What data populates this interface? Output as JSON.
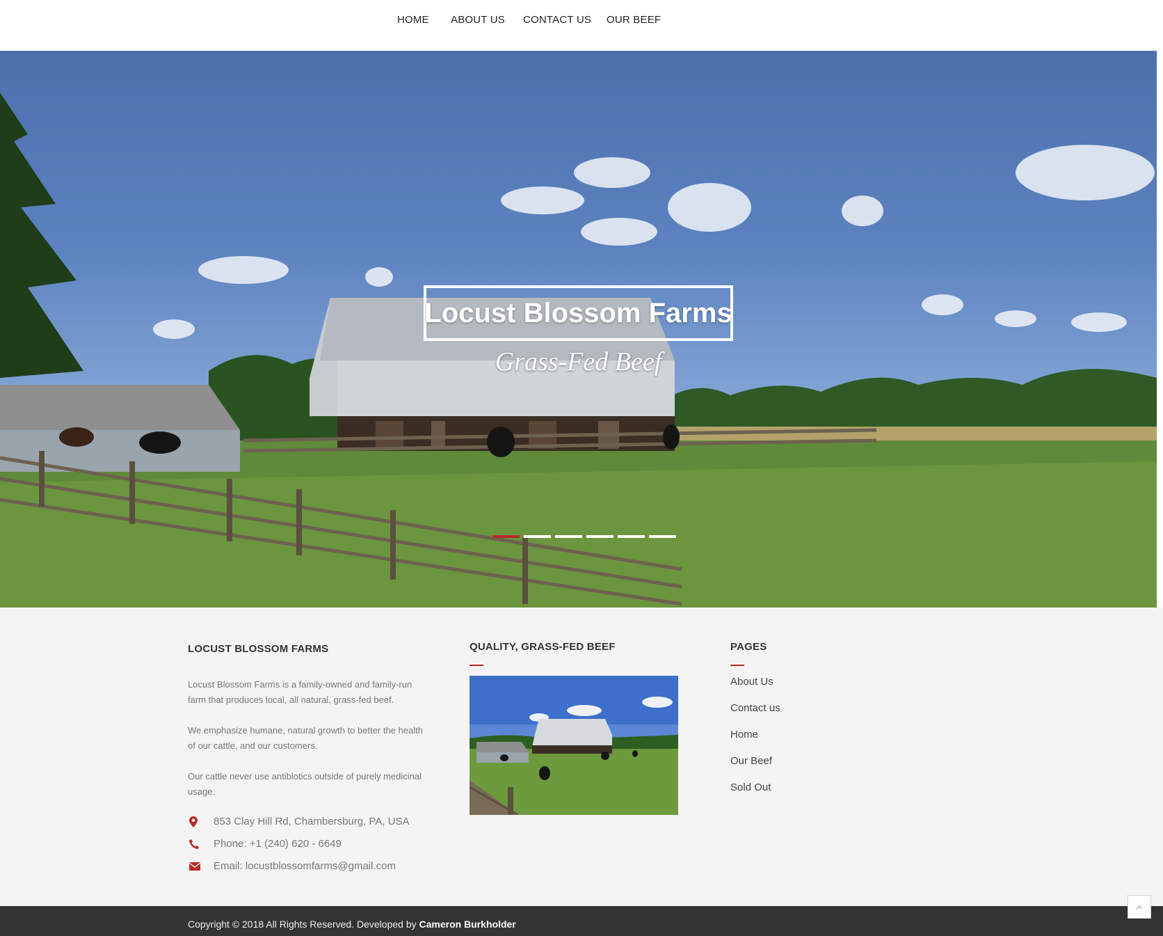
{
  "nav": {
    "items": [
      {
        "label": "HOME"
      },
      {
        "label": "ABOUT US"
      },
      {
        "label": "CONTACT US"
      },
      {
        "label": "OUR BEEF"
      }
    ]
  },
  "hero": {
    "title": "Locust Blossom Farms",
    "subtitle": "Grass-Fed Beef",
    "slides_total": 6,
    "active_slide": 1
  },
  "footer": {
    "about": {
      "heading": "LOCUST BLOSSOM FARMS",
      "paragraphs": [
        "Locust Blossom Farms is a family-owned and family-run farm that produces local, all natural, grass-fed beef.",
        "We emphasize humane, natural growth to better the health of our cattle, and our customers.",
        "Our cattle never use antibiotics outside of purely medicinal usage."
      ],
      "address": "853 Clay Hill Rd, Chambersburg, PA, USA",
      "phone": "Phone: +1 (240) 620 - 6649",
      "email": "Email: locustblossomfarms@gmail.com"
    },
    "gallery": {
      "heading": "QUALITY, GRASS-FED BEEF"
    },
    "pages": {
      "heading": "PAGES",
      "links": [
        "About Us",
        "Contact us",
        "Home",
        "Our Beef",
        "Sold Out"
      ]
    }
  },
  "bottom": {
    "copyright": "Copyright © 2018 All Rights Reserved. Developed by",
    "developer": "Cameron Burkholder"
  },
  "colors": {
    "accent": "#b92b27",
    "footer_bg": "#f4f4f4",
    "bottom_bar": "#333333"
  },
  "icons": [
    "map-marker-icon",
    "phone-icon",
    "envelope-icon",
    "chevron-up-icon"
  ]
}
